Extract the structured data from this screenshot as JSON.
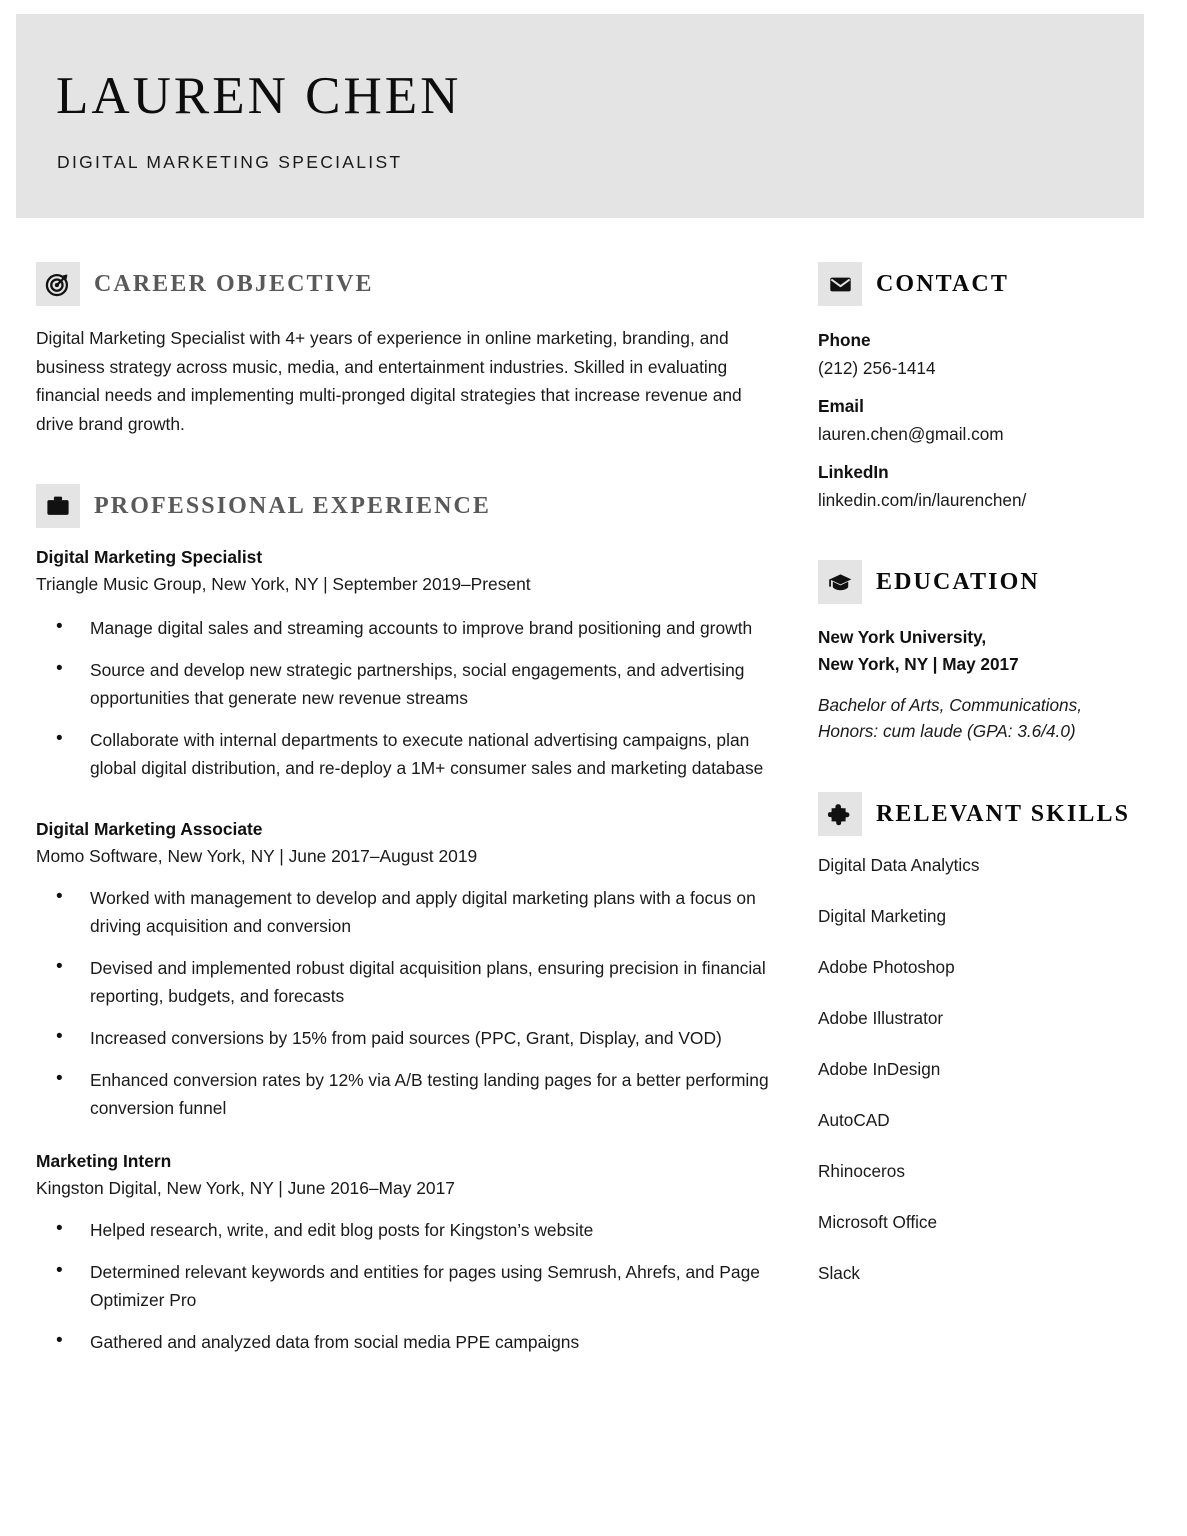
{
  "header": {
    "name": "LAUREN CHEN",
    "subtitle": "DIGITAL MARKETING SPECIALIST",
    "band_color": "#e4e4e4"
  },
  "sections": {
    "objective": {
      "title": "CAREER OBJECTIVE",
      "icon": "target-icon",
      "text": "Digital Marketing Specialist with 4+ years of experience in online marketing, branding, and business strategy across music, media, and entertainment industries. Skilled in evaluating financial needs and implementing multi-pronged digital strategies that increase revenue and drive brand growth."
    },
    "experience": {
      "title": "PROFESSIONAL EXPERIENCE",
      "icon": "briefcase-icon",
      "jobs": [
        {
          "title": "Digital Marketing Specialist",
          "meta": "Triangle Music Group, New York, NY | September 2019–Present",
          "bullets": [
            "Manage digital sales and streaming accounts to improve brand positioning and growth",
            "Source and develop new strategic partnerships, social engagements, and advertising opportunities that generate new revenue streams",
            "Collaborate with internal departments to execute national advertising campaigns, plan global digital distribution, and re-deploy a 1M+ consumer sales and marketing database"
          ]
        },
        {
          "title": "Digital Marketing Associate",
          "meta": "Momo Software, New York, NY | June 2017–August 2019",
          "bullets": [
            "Worked with management to develop and apply digital marketing plans with a focus on driving acquisition and conversion",
            "Devised and implemented robust digital acquisition plans, ensuring precision in financial reporting, budgets, and forecasts",
            "Increased conversions by 15% from paid sources (PPC, Grant, Display, and VOD)",
            "Enhanced conversion rates by 12% via A/B testing landing pages for a better performing conversion funnel"
          ]
        },
        {
          "title": "Marketing Intern",
          "meta": "Kingston Digital, New York, NY | June 2016–May 2017",
          "bullets": [
            "Helped research, write, and edit blog posts for Kingston’s website",
            "Determined relevant keywords and entities for pages using Semrush, Ahrefs, and Page Optimizer Pro",
            "Gathered and analyzed data from social media PPE campaigns"
          ]
        }
      ]
    },
    "contact": {
      "title": "CONTACT",
      "icon": "envelope-icon",
      "items": [
        {
          "label": "Phone",
          "value": "(212) 256-1414"
        },
        {
          "label": "Email",
          "value": "lauren.chen@gmail.com"
        },
        {
          "label": "LinkedIn",
          "value": "linkedin.com/in/laurenchen/"
        }
      ]
    },
    "education": {
      "title": "EDUCATION",
      "icon": "graduation-cap-icon",
      "school_line1": "New York University,",
      "school_line2": "New York, NY | May 2017",
      "degree_line1": "Bachelor of Arts, Communications,",
      "degree_line2": "Honors: cum laude (GPA: 3.6/4.0)"
    },
    "skills": {
      "title": "RELEVANT SKILLS",
      "icon": "puzzle-piece-icon",
      "items": [
        "Digital Data Analytics",
        "Digital Marketing",
        "Adobe Photoshop",
        "Adobe Illustrator",
        "Adobe InDesign",
        "AutoCAD",
        "Rhinoceros",
        "Microsoft Office",
        "Slack"
      ]
    }
  }
}
